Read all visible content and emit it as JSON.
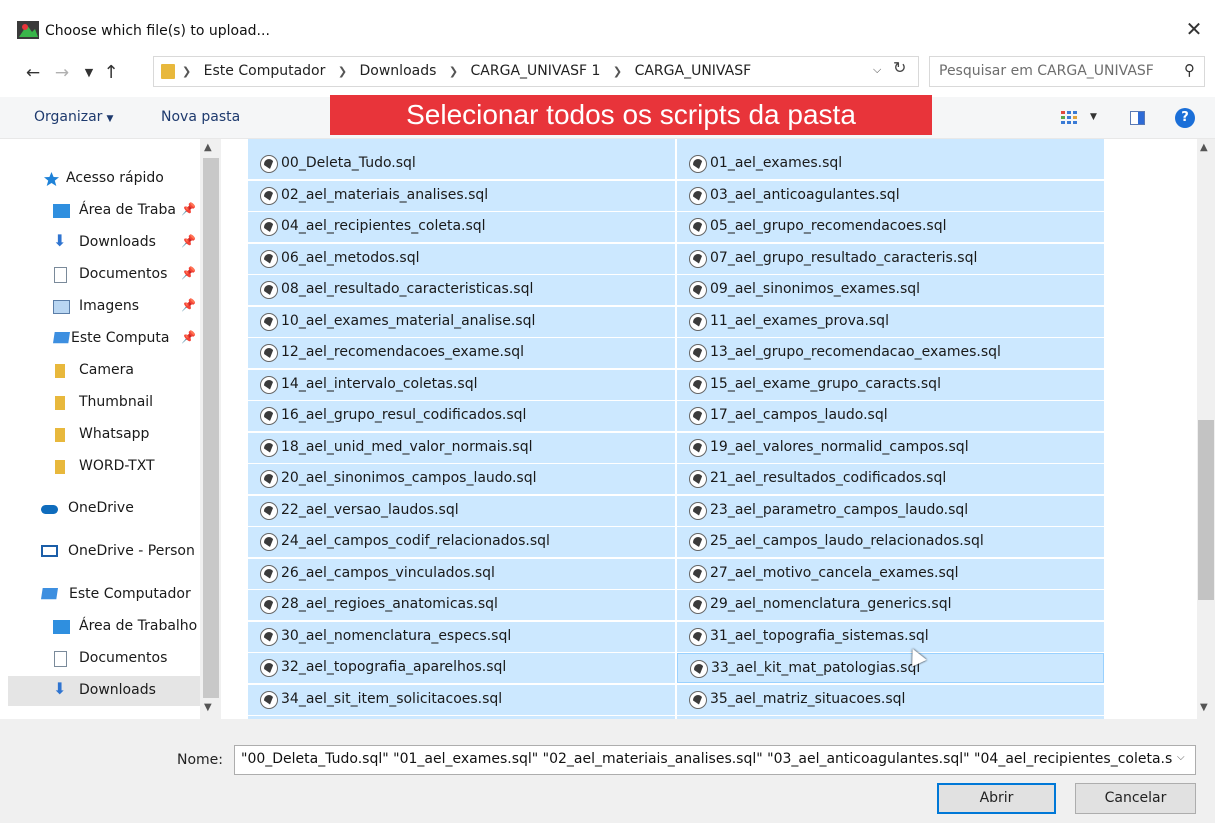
{
  "window": {
    "title": "Choose which file(s) to upload..."
  },
  "nav": {
    "crumbs": [
      "Este Computador",
      "Downloads",
      "CARGA_UNIVASF 1",
      "CARGA_UNIVASF"
    ],
    "search_placeholder": "Pesquisar em CARGA_UNIVASF"
  },
  "toolbar": {
    "organize_label": "Organizar",
    "new_folder_label": "Nova pasta",
    "banner_text": "Selecionar todos os scripts da pasta"
  },
  "sidebar": {
    "items": [
      {
        "label": "Acesso rápido",
        "icon": "star-icon",
        "pinned": false
      },
      {
        "label": "Área de Traba",
        "icon": "desktop-icon",
        "pinned": true
      },
      {
        "label": "Downloads",
        "icon": "download-arrow-icon",
        "pinned": true
      },
      {
        "label": "Documentos",
        "icon": "document-icon",
        "pinned": true
      },
      {
        "label": "Imagens",
        "icon": "picture-icon",
        "pinned": true
      },
      {
        "label": "Este Computa",
        "icon": "computer-icon",
        "pinned": true
      },
      {
        "label": "Camera",
        "icon": "folder-icon",
        "pinned": false
      },
      {
        "label": "Thumbnail",
        "icon": "folder-icon",
        "pinned": false
      },
      {
        "label": "Whatsapp",
        "icon": "folder-icon",
        "pinned": false
      },
      {
        "label": "WORD-TXT",
        "icon": "folder-icon",
        "pinned": false
      },
      {
        "label": "OneDrive",
        "icon": "cloud-icon",
        "pinned": false
      },
      {
        "label": "OneDrive - Person",
        "icon": "onedrive-business-icon",
        "pinned": false
      },
      {
        "label": "Este Computador",
        "icon": "computer-icon",
        "pinned": false
      },
      {
        "label": "Área de Trabalho",
        "icon": "desktop-icon",
        "pinned": false
      },
      {
        "label": "Documentos",
        "icon": "document-icon",
        "pinned": false
      },
      {
        "label": "Downloads",
        "icon": "download-arrow-icon",
        "pinned": false,
        "selected": true
      }
    ]
  },
  "files": {
    "left": [
      "00_Deleta_Tudo.sql",
      "02_ael_materiais_analises.sql",
      "04_ael_recipientes_coleta.sql",
      "06_ael_metodos.sql",
      "08_ael_resultado_caracteristicas.sql",
      "10_ael_exames_material_analise.sql",
      "12_ael_recomendacoes_exame.sql",
      "14_ael_intervalo_coletas.sql",
      "16_ael_grupo_resul_codificados.sql",
      "18_ael_unid_med_valor_normais.sql",
      "20_ael_sinonimos_campos_laudo.sql",
      "22_ael_versao_laudos.sql",
      "24_ael_campos_codif_relacionados.sql",
      "26_ael_campos_vinculados.sql",
      "28_ael_regioes_anatomicas.sql",
      "30_ael_nomenclatura_especs.sql",
      "32_ael_topografia_aparelhos.sql",
      "34_ael_sit_item_solicitacoes.sql"
    ],
    "right": [
      "01_ael_exames.sql",
      "03_ael_anticoagulantes.sql",
      "05_ael_grupo_recomendacoes.sql",
      "07_ael_grupo_resultado_caracteris.sql",
      "09_ael_sinonimos_exames.sql",
      "11_ael_exames_prova.sql",
      "13_ael_grupo_recomendacao_exames.sql",
      "15_ael_exame_grupo_caracts.sql",
      "17_ael_campos_laudo.sql",
      "19_ael_valores_normalid_campos.sql",
      "21_ael_resultados_codificados.sql",
      "23_ael_parametro_campos_laudo.sql",
      "25_ael_campos_laudo_relacionados.sql",
      "27_ael_motivo_cancela_exames.sql",
      "29_ael_nomenclatura_generics.sql",
      "31_ael_topografia_sistemas.sql",
      "33_ael_kit_mat_patologias.sql",
      "35_ael_matriz_situacoes.sql"
    ]
  },
  "bottom": {
    "name_label": "Nome:",
    "name_value": "\"00_Deleta_Tudo.sql\" \"01_ael_exames.sql\" \"02_ael_materiais_analises.sql\" \"03_ael_anticoagulantes.sql\" \"04_ael_recipientes_coleta.s",
    "open_label": "Abrir",
    "cancel_label": "Cancelar"
  },
  "colors": {
    "selection": "#cce8ff",
    "banner": "#e8343a",
    "accent": "#0078d7"
  }
}
